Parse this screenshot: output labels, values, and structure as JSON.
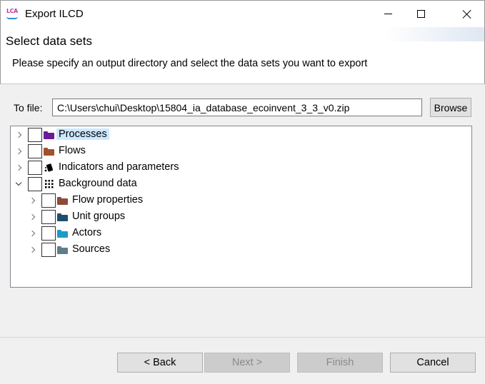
{
  "window": {
    "title": "Export ILCD",
    "icon_text": "LCA",
    "controls": [
      "minimize",
      "maximize",
      "close"
    ]
  },
  "header": {
    "heading": "Select data sets",
    "description": "Please specify an output directory and select the data sets you want to export"
  },
  "file": {
    "label": "To file:",
    "value": "C:\\Users\\chui\\Desktop\\15804_ia_database_ecoinvent_3_3_v0.zip",
    "browse_label": "Browse"
  },
  "tree": {
    "items": [
      {
        "label": "Processes",
        "icon": "folder-icon",
        "color": "#6a1b9a",
        "expanded": false,
        "checked": false,
        "selected": true
      },
      {
        "label": "Flows",
        "icon": "folder-icon",
        "color": "#a0522d",
        "expanded": false,
        "checked": false,
        "selected": false
      },
      {
        "label": "Indicators and parameters",
        "icon": "indicator-icon",
        "color": "#000000",
        "expanded": false,
        "checked": false,
        "selected": false
      },
      {
        "label": "Background data",
        "icon": "grid-icon",
        "color": "#000000",
        "expanded": true,
        "checked": false,
        "selected": false,
        "children": [
          {
            "label": "Flow properties",
            "icon": "folder-icon",
            "color": "#8d4b3a",
            "expanded": false,
            "checked": false
          },
          {
            "label": "Unit groups",
            "icon": "folder-icon",
            "color": "#1f4e6b",
            "expanded": false,
            "checked": false
          },
          {
            "label": "Actors",
            "icon": "folder-icon",
            "color": "#1e9ac8",
            "expanded": false,
            "checked": false
          },
          {
            "label": "Sources",
            "icon": "folder-icon",
            "color": "#607d8b",
            "expanded": false,
            "checked": false
          }
        ]
      }
    ]
  },
  "buttons": {
    "back": {
      "label": "< Back",
      "enabled": true
    },
    "next": {
      "label": "Next >",
      "enabled": false
    },
    "finish": {
      "label": "Finish",
      "enabled": false
    },
    "cancel": {
      "label": "Cancel",
      "enabled": true
    }
  }
}
